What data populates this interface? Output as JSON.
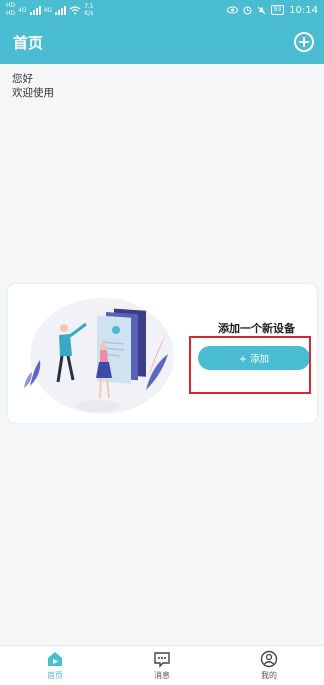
{
  "status_bar": {
    "sim1": "HD",
    "sim2": "HD",
    "net1": "4G",
    "net2": "4G",
    "speed_value": "7.1",
    "speed_unit": "K/s",
    "battery": "93",
    "time": "10:14"
  },
  "app_bar": {
    "title": "首页",
    "add_icon": "plus-circle-icon"
  },
  "greeting": {
    "line1": "您好",
    "line2": "欢迎使用"
  },
  "device_card": {
    "title": "添加一个新设备",
    "button_label": "+ 添加",
    "highlight_color": "#cf2a37"
  },
  "bottom_nav": {
    "items": [
      {
        "label": "首页",
        "icon": "home-icon",
        "active": true
      },
      {
        "label": "消息",
        "icon": "message-icon",
        "active": false
      },
      {
        "label": "我的",
        "icon": "profile-icon",
        "active": false
      }
    ]
  },
  "colors": {
    "primary": "#4bbdd2",
    "background": "#f5f6f8"
  }
}
